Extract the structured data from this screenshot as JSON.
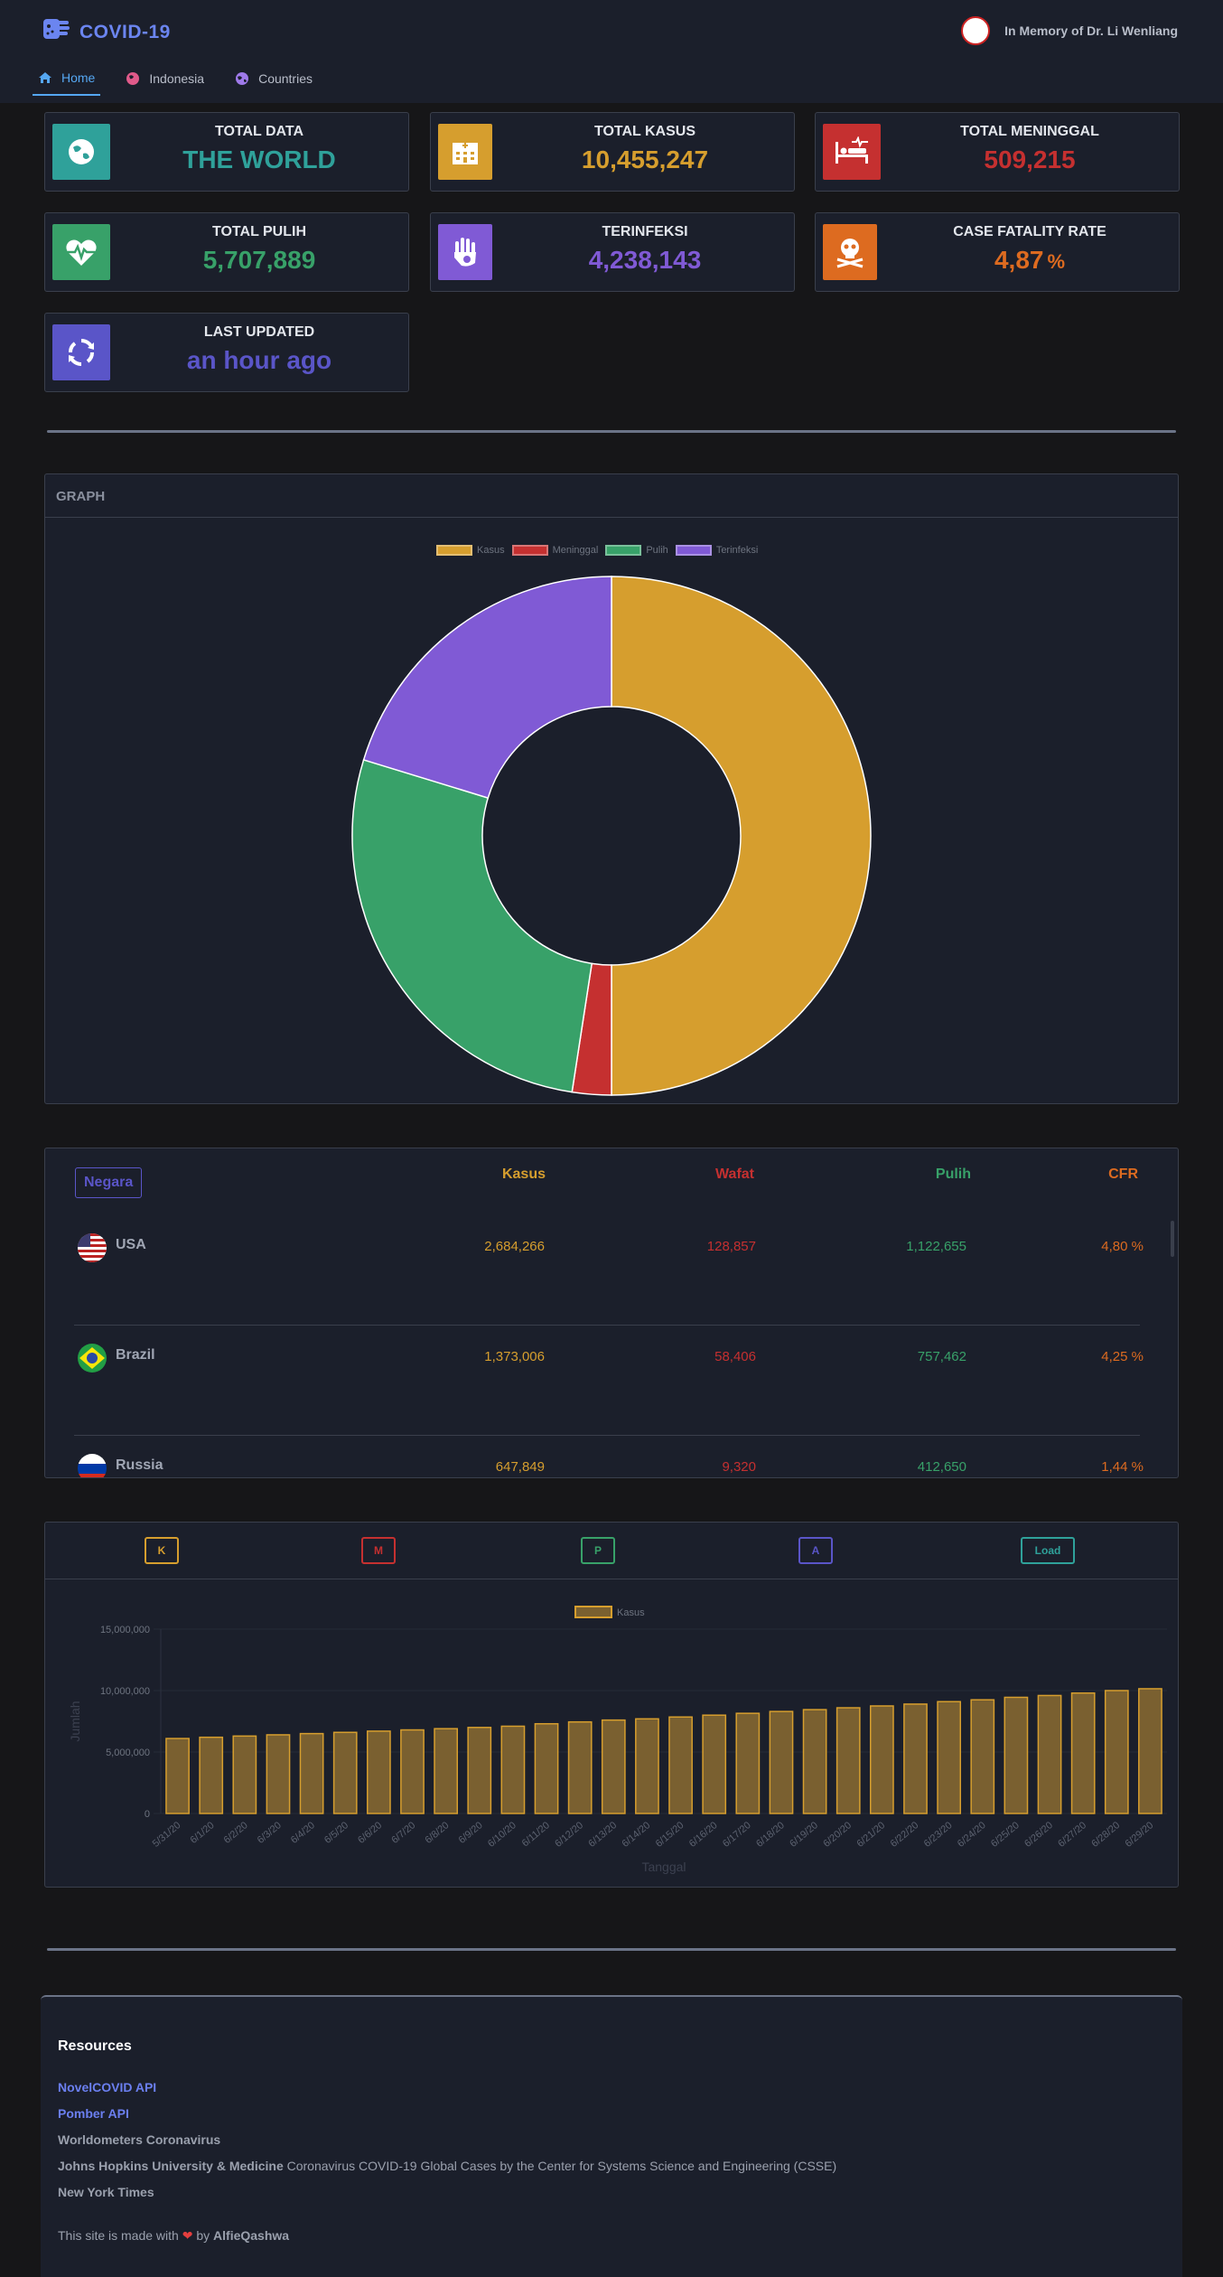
{
  "app": {
    "title": "COVID-19",
    "memorial": "In Memory of Dr. Li Wenliang"
  },
  "nav": {
    "items": [
      {
        "label": "Home"
      },
      {
        "label": "Indonesia"
      },
      {
        "label": "Countries"
      }
    ]
  },
  "stats": {
    "total_data": {
      "title": "TOTAL DATA",
      "value": "THE WORLD",
      "color": "#2fa19a"
    },
    "total_kasus": {
      "title": "TOTAL KASUS",
      "value": "10,455,247",
      "color": "#d69e2e"
    },
    "total_meninggal": {
      "title": "TOTAL MENINGGAL",
      "value": "509,215",
      "color": "#c53030"
    },
    "total_pulih": {
      "title": "TOTAL PULIH",
      "value": "5,707,889",
      "color": "#38a169"
    },
    "terinfeksi": {
      "title": "TERINFEKSI",
      "value": "4,238,143",
      "color": "#805ad5"
    },
    "cfr": {
      "title": "CASE FATALITY RATE",
      "value": "4,87",
      "unit": "%",
      "color": "#dd6b20"
    },
    "last_updated": {
      "title": "LAST UPDATED",
      "value": "an hour ago",
      "color": "#5a55c8"
    }
  },
  "graph": {
    "header": "GRAPH",
    "chart_data": {
      "type": "pie",
      "labels": [
        "Kasus",
        "Meninggal",
        "Pulih",
        "Terinfeksi"
      ],
      "values": [
        10455247,
        509215,
        5707889,
        4238143
      ],
      "colors": [
        "#d69e2e",
        "#c53030",
        "#38a169",
        "#805ad5"
      ]
    }
  },
  "table": {
    "headers": {
      "country": "Negara",
      "cases": "Kasus",
      "deaths": "Wafat",
      "recovered": "Pulih",
      "cfr": "CFR"
    },
    "rows": [
      {
        "country": "USA",
        "cases": "2,684,266",
        "deaths": "128,857",
        "recovered": "1,122,655",
        "cfr": "4,80 %"
      },
      {
        "country": "Brazil",
        "cases": "1,373,006",
        "deaths": "58,406",
        "recovered": "757,462",
        "cfr": "4,25 %"
      },
      {
        "country": "Russia",
        "cases": "647,849",
        "deaths": "9,320",
        "recovered": "412,650",
        "cfr": "1,44 %"
      }
    ]
  },
  "timeline": {
    "buttons": {
      "k": "K",
      "m": "M",
      "p": "P",
      "a": "A",
      "load": "Load"
    },
    "chart_data": {
      "type": "bar",
      "title": "",
      "xlabel": "Tanggal",
      "ylabel": "Jumlah",
      "ylim": [
        0,
        15000000
      ],
      "yticks": [
        "15,000,000",
        "10,000,000",
        "5,000,000",
        "0"
      ],
      "categories": [
        "5/31/20",
        "6/1/20",
        "6/2/20",
        "6/3/20",
        "6/4/20",
        "6/5/20",
        "6/6/20",
        "6/7/20",
        "6/8/20",
        "6/9/20",
        "6/10/20",
        "6/11/20",
        "6/12/20",
        "6/13/20",
        "6/14/20",
        "6/15/20",
        "6/16/20",
        "6/17/20",
        "6/18/20",
        "6/19/20",
        "6/20/20",
        "6/21/20",
        "6/22/20",
        "6/23/20",
        "6/24/20",
        "6/25/20",
        "6/26/20",
        "6/27/20",
        "6/28/20",
        "6/29/20"
      ],
      "series": [
        {
          "name": "Kasus",
          "color": "#d69e2e",
          "values": [
            6100000,
            6200000,
            6300000,
            6400000,
            6500000,
            6600000,
            6700000,
            6800000,
            6900000,
            7000000,
            7100000,
            7300000,
            7450000,
            7600000,
            7700000,
            7850000,
            8000000,
            8150000,
            8300000,
            8450000,
            8600000,
            8750000,
            8900000,
            9100000,
            9250000,
            9450000,
            9600000,
            9800000,
            10000000,
            10150000
          ]
        }
      ]
    }
  },
  "footer": {
    "heading": "Resources",
    "links": [
      {
        "bold": "NovelCOVID API",
        "rest": ""
      },
      {
        "bold": "Pomber API",
        "rest": ""
      },
      {
        "bold": "Worldometers Coronavirus",
        "rest": ""
      },
      {
        "bold": "Johns Hopkins University & Medicine",
        "rest": " Coronavirus COVID-19 Global Cases by the Center for Systems Science and Engineering (CSSE)"
      },
      {
        "bold": "New York Times",
        "rest": ""
      }
    ],
    "made_prefix": "This site is made with",
    "made_by": "by",
    "author": "AlfieQashwa"
  }
}
